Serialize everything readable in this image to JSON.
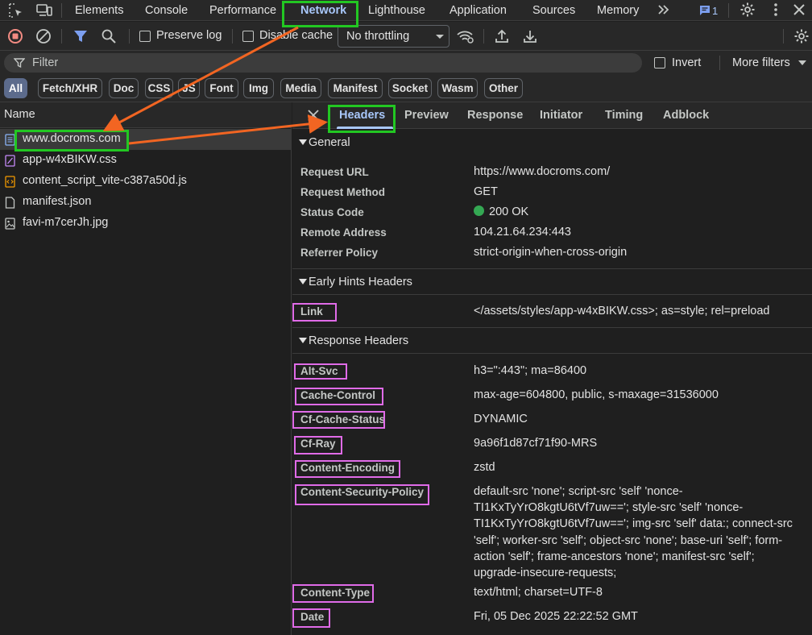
{
  "top_tabs": [
    "Elements",
    "Console",
    "Performance",
    "Network",
    "Lighthouse",
    "Application",
    "Sources",
    "Memory"
  ],
  "top_right": {
    "message_count": "1"
  },
  "toolbar": {
    "preserve_log_label": "Preserve log",
    "disable_cache_label": "Disable cache",
    "throttling_value": "No throttling"
  },
  "filter": {
    "placeholder": "Filter",
    "invert_label": "Invert",
    "more_filters_label": "More filters"
  },
  "type_chips": [
    "All",
    "Fetch/XHR",
    "Doc",
    "CSS",
    "JS",
    "Font",
    "Img",
    "Media",
    "Manifest",
    "Socket",
    "Wasm",
    "Other"
  ],
  "requests": {
    "column_header": "Name",
    "items": [
      {
        "name": "www.docroms.com",
        "icon": "document-icon"
      },
      {
        "name": "app-w4xBIKW.css",
        "icon": "stylesheet-icon"
      },
      {
        "name": "content_script_vite-c387a50d.js",
        "icon": "script-icon"
      },
      {
        "name": "manifest.json",
        "icon": "file-icon"
      },
      {
        "name": "favi-m7cerJh.jpg",
        "icon": "image-icon"
      }
    ]
  },
  "detail_tabs": [
    "Headers",
    "Preview",
    "Response",
    "Initiator",
    "Timing",
    "Adblock"
  ],
  "general": {
    "title": "General",
    "rows": [
      {
        "key": "Request URL",
        "value": "https://www.docroms.com/"
      },
      {
        "key": "Request Method",
        "value": "GET"
      },
      {
        "key": "Status Code",
        "value": "200 OK"
      },
      {
        "key": "Remote Address",
        "value": "104.21.64.234:443"
      },
      {
        "key": "Referrer Policy",
        "value": "strict-origin-when-cross-origin"
      }
    ]
  },
  "early_hints": {
    "title": "Early Hints Headers",
    "rows": [
      {
        "key": "Link",
        "value": "</assets/styles/app-w4xBIKW.css>; as=style; rel=preload"
      }
    ]
  },
  "response_headers": {
    "title": "Response Headers",
    "rows": [
      {
        "key": "Alt-Svc",
        "value": "h3=\":443\"; ma=86400"
      },
      {
        "key": "Cache-Control",
        "value": "max-age=604800, public, s-maxage=31536000"
      },
      {
        "key": "Cf-Cache-Status",
        "value": "DYNAMIC"
      },
      {
        "key": "Cf-Ray",
        "value": "9a96f1d87cf71f90-MRS"
      },
      {
        "key": "Content-Encoding",
        "value": "zstd"
      },
      {
        "key": "Content-Security-Policy",
        "value": "default-src 'none'; script-src 'self' 'nonce-TI1KxTyYrO8kgtU6tVf7uw=='; style-src 'self' 'nonce-TI1KxTyYrO8kgtU6tVf7uw=='; img-src 'self' data:; connect-src 'self'; worker-src 'self'; object-src 'none'; base-uri 'self'; form-action 'self'; frame-ancestors 'none'; manifest-src 'self'; upgrade-insecure-requests;"
      },
      {
        "key": "Content-Type",
        "value": "text/html; charset=UTF-8"
      },
      {
        "key": "Date",
        "value": "Fri, 05 Dec 2025 22:22:52 GMT"
      }
    ]
  },
  "colors": {
    "accent": "#a8c7fa",
    "annotation_green": "#22c722",
    "annotation_pink": "#e06be8",
    "annotation_arrow": "#f26522",
    "status_ok": "#34a853",
    "record_red": "#f28b82"
  }
}
